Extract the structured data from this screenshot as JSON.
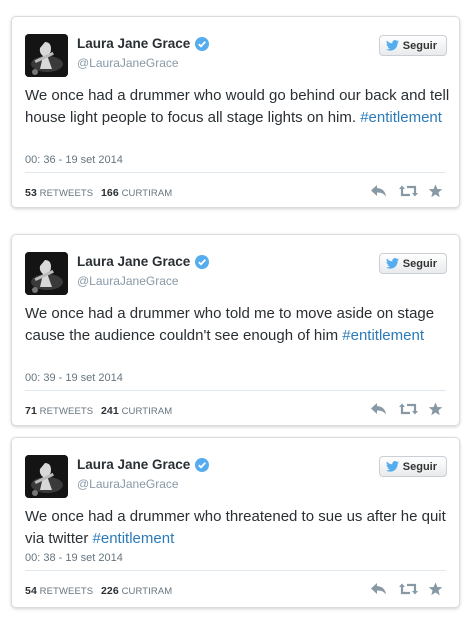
{
  "tweets": [
    {
      "name": "Laura Jane Grace",
      "handle": "@LauraJaneGrace",
      "follow_label": "Seguir",
      "text": "We once had a drummer who would go behind our back and tell house light people to focus all stage lights on him. ",
      "hashtag": "#entitlement",
      "timestamp": "00: 36 - 19 set 2014",
      "retweets": "53",
      "retweets_label": "RETWEETS",
      "likes": "166",
      "likes_label": "CURTIRAM"
    },
    {
      "name": "Laura Jane Grace",
      "handle": "@LauraJaneGrace",
      "follow_label": "Seguir",
      "text": "We once had a drummer who told me to move aside on stage cause the audience couldn't see enough of him ",
      "hashtag": "#entitlement",
      "timestamp": "00: 39 - 19 set 2014",
      "retweets": "71",
      "retweets_label": "RETWEETS",
      "likes": "241",
      "likes_label": "CURTIRAM"
    },
    {
      "name": "Laura Jane Grace",
      "handle": "@LauraJaneGrace",
      "follow_label": "Seguir",
      "text": "We once had a drummer who threatened to sue us after he quit via twitter ",
      "hashtag": "#entitlement",
      "timestamp": "00: 38 - 19 set 2014",
      "retweets": "54",
      "retweets_label": "RETWEETS",
      "likes": "226",
      "likes_label": "CURTIRAM"
    }
  ],
  "icons": {
    "verified": "verified-badge-icon",
    "follow": "bird-icon",
    "reply": "reply-icon",
    "retweet": "retweet-icon",
    "favorite": "star-icon"
  },
  "colors": {
    "hashtag": "#2b7bb9",
    "verified": "#55acee",
    "action_icon": "#8899a6"
  }
}
